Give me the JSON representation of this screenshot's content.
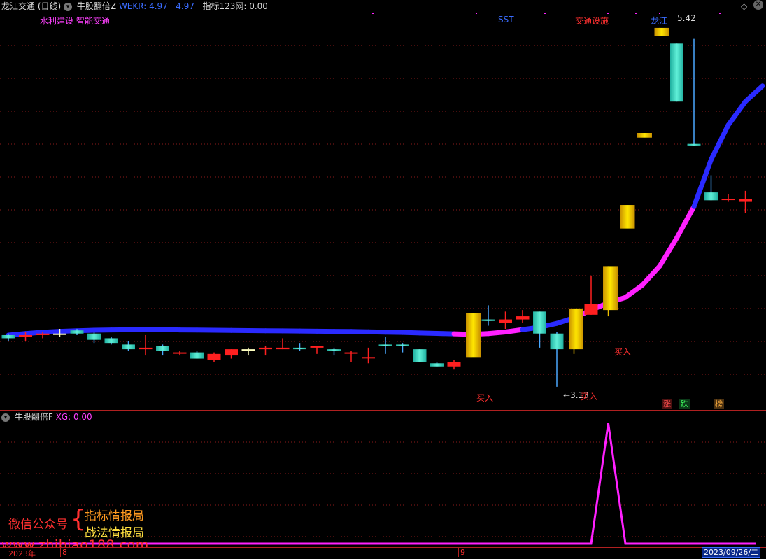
{
  "header": {
    "stock_name": "龙江交通",
    "period": "(日线)",
    "indicator_name": "牛股翻倍Z",
    "wekr_label": "WEKR:",
    "wekr_value": "4.97",
    "value2": "4.97",
    "index_label": "指标123网:",
    "index_value": "0.00"
  },
  "main_annotations": {
    "concepts": "水利建设 智能交通",
    "sst": "SST",
    "sector": "交通设施",
    "dragon_label": "龙江",
    "high_price": "5.42",
    "low_price": "3.13",
    "buy1": "买入",
    "buy2": "买入",
    "buy3": "买入"
  },
  "badges": {
    "rise": "涨",
    "fall": "跌",
    "rank": "榜"
  },
  "sub_header": {
    "name": "牛股翻倍F",
    "xg_label": "XG:",
    "xg_value": "0.00"
  },
  "watermark": {
    "wechat_label": "微信公众号",
    "brace": "{",
    "line1": "指标情报局",
    "line2": "战法情报局",
    "url": "www.zhibiao188.com"
  },
  "axis": {
    "year": "2023年",
    "tick1": "8",
    "tick2": "9",
    "date": "2023/09/26/二"
  },
  "colors": {
    "up": "#ff2020",
    "down": "#40d8c0",
    "gold": "#f0c000",
    "ma_blue": "#2a2aff",
    "ma_magenta": "#ff20ff",
    "grid": "#8b1a1a"
  },
  "chart_data": {
    "type": "candlestick",
    "y_range": [
      3.0,
      5.5
    ],
    "candles": [
      {
        "o": 3.46,
        "h": 3.47,
        "l": 3.42,
        "c": 3.44,
        "t": "down"
      },
      {
        "o": 3.45,
        "h": 3.48,
        "l": 3.42,
        "c": 3.46,
        "t": "up"
      },
      {
        "o": 3.46,
        "h": 3.48,
        "l": 3.44,
        "c": 3.47,
        "t": "up"
      },
      {
        "o": 3.47,
        "h": 3.5,
        "l": 3.45,
        "c": 3.47,
        "t": "doji"
      },
      {
        "o": 3.49,
        "h": 3.5,
        "l": 3.46,
        "c": 3.47,
        "t": "down"
      },
      {
        "o": 3.47,
        "h": 3.48,
        "l": 3.41,
        "c": 3.43,
        "t": "down"
      },
      {
        "o": 3.44,
        "h": 3.45,
        "l": 3.4,
        "c": 3.41,
        "t": "down"
      },
      {
        "o": 3.4,
        "h": 3.42,
        "l": 3.36,
        "c": 3.37,
        "t": "down"
      },
      {
        "o": 3.37,
        "h": 3.46,
        "l": 3.33,
        "c": 3.38,
        "t": "up"
      },
      {
        "o": 3.39,
        "h": 3.4,
        "l": 3.33,
        "c": 3.36,
        "t": "down"
      },
      {
        "o": 3.35,
        "h": 3.36,
        "l": 3.33,
        "c": 3.35,
        "t": "up"
      },
      {
        "o": 3.35,
        "h": 3.36,
        "l": 3.31,
        "c": 3.31,
        "t": "down"
      },
      {
        "o": 3.3,
        "h": 3.35,
        "l": 3.29,
        "c": 3.34,
        "t": "up"
      },
      {
        "o": 3.33,
        "h": 3.37,
        "l": 3.31,
        "c": 3.37,
        "t": "up"
      },
      {
        "o": 3.37,
        "h": 3.38,
        "l": 3.33,
        "c": 3.37,
        "t": "doji"
      },
      {
        "o": 3.37,
        "h": 3.39,
        "l": 3.33,
        "c": 3.38,
        "t": "up"
      },
      {
        "o": 3.37,
        "h": 3.44,
        "l": 3.37,
        "c": 3.38,
        "t": "up"
      },
      {
        "o": 3.38,
        "h": 3.41,
        "l": 3.36,
        "c": 3.37,
        "t": "down"
      },
      {
        "o": 3.38,
        "h": 3.39,
        "l": 3.34,
        "c": 3.39,
        "t": "up"
      },
      {
        "o": 3.37,
        "h": 3.38,
        "l": 3.33,
        "c": 3.36,
        "t": "down"
      },
      {
        "o": 3.35,
        "h": 3.36,
        "l": 3.29,
        "c": 3.35,
        "t": "up"
      },
      {
        "o": 3.32,
        "h": 3.38,
        "l": 3.28,
        "c": 3.32,
        "t": "up"
      },
      {
        "o": 3.39,
        "h": 3.45,
        "l": 3.34,
        "c": 3.4,
        "t": "down"
      },
      {
        "o": 3.39,
        "h": 3.41,
        "l": 3.35,
        "c": 3.4,
        "t": "down"
      },
      {
        "o": 3.37,
        "h": 3.37,
        "l": 3.29,
        "c": 3.29,
        "t": "down"
      },
      {
        "o": 3.28,
        "h": 3.29,
        "l": 3.26,
        "c": 3.26,
        "t": "down"
      },
      {
        "o": 3.26,
        "h": 3.3,
        "l": 3.24,
        "c": 3.29,
        "t": "up"
      },
      {
        "o": 3.32,
        "h": 3.6,
        "l": 3.32,
        "c": 3.6,
        "t": "gold"
      },
      {
        "o": 3.56,
        "h": 3.65,
        "l": 3.52,
        "c": 3.55,
        "t": "down"
      },
      {
        "o": 3.56,
        "h": 3.61,
        "l": 3.5,
        "c": 3.54,
        "t": "up"
      },
      {
        "o": 3.58,
        "h": 3.62,
        "l": 3.54,
        "c": 3.56,
        "t": "up"
      },
      {
        "o": 3.61,
        "h": 3.61,
        "l": 3.38,
        "c": 3.47,
        "t": "down"
      },
      {
        "o": 3.47,
        "h": 3.48,
        "l": 3.13,
        "c": 3.37,
        "t": "down"
      },
      {
        "o": 3.37,
        "h": 3.63,
        "l": 3.34,
        "c": 3.63,
        "t": "gold"
      },
      {
        "o": 3.59,
        "h": 3.84,
        "l": 3.59,
        "c": 3.66,
        "t": "up"
      },
      {
        "o": 3.62,
        "h": 3.9,
        "l": 3.58,
        "c": 3.9,
        "t": "gold"
      },
      {
        "o": 4.29,
        "h": 4.29,
        "l": 4.29,
        "c": 4.14,
        "t": "gold"
      },
      {
        "o": 4.75,
        "h": 4.75,
        "l": 4.73,
        "c": 4.72,
        "t": "gold"
      },
      {
        "o": 5.42,
        "h": 5.42,
        "l": 5.37,
        "c": 5.37,
        "t": "gold"
      },
      {
        "o": 5.32,
        "h": 5.32,
        "l": 4.95,
        "c": 4.95,
        "t": "down"
      },
      {
        "o": 4.68,
        "h": 5.35,
        "l": 4.67,
        "c": 4.67,
        "t": "down"
      },
      {
        "o": 4.37,
        "h": 4.48,
        "l": 4.32,
        "c": 4.32,
        "t": "down"
      },
      {
        "o": 4.33,
        "h": 4.36,
        "l": 4.31,
        "c": 4.33,
        "t": "up"
      },
      {
        "o": 4.31,
        "h": 4.38,
        "l": 4.24,
        "c": 4.33,
        "t": "up"
      }
    ],
    "ma_line": [
      {
        "v": 3.46,
        "c": "blue"
      },
      {
        "v": 3.47,
        "c": "blue"
      },
      {
        "v": 3.478,
        "c": "blue"
      },
      {
        "v": 3.484,
        "c": "blue"
      },
      {
        "v": 3.488,
        "c": "blue"
      },
      {
        "v": 3.491,
        "c": "blue"
      },
      {
        "v": 3.493,
        "c": "blue"
      },
      {
        "v": 3.494,
        "c": "blue"
      },
      {
        "v": 3.494,
        "c": "blue"
      },
      {
        "v": 3.494,
        "c": "blue"
      },
      {
        "v": 3.493,
        "c": "blue"
      },
      {
        "v": 3.492,
        "c": "blue"
      },
      {
        "v": 3.491,
        "c": "blue"
      },
      {
        "v": 3.49,
        "c": "blue"
      },
      {
        "v": 3.489,
        "c": "blue"
      },
      {
        "v": 3.488,
        "c": "blue"
      },
      {
        "v": 3.487,
        "c": "blue"
      },
      {
        "v": 3.486,
        "c": "blue"
      },
      {
        "v": 3.485,
        "c": "blue"
      },
      {
        "v": 3.484,
        "c": "blue"
      },
      {
        "v": 3.483,
        "c": "blue"
      },
      {
        "v": 3.481,
        "c": "blue"
      },
      {
        "v": 3.479,
        "c": "blue"
      },
      {
        "v": 3.477,
        "c": "blue"
      },
      {
        "v": 3.474,
        "c": "blue"
      },
      {
        "v": 3.471,
        "c": "blue"
      },
      {
        "v": 3.468,
        "c": "blue"
      },
      {
        "v": 3.465,
        "c": "magenta"
      },
      {
        "v": 3.47,
        "c": "magenta"
      },
      {
        "v": 3.48,
        "c": "magenta"
      },
      {
        "v": 3.495,
        "c": "magenta"
      },
      {
        "v": 3.51,
        "c": "blue"
      },
      {
        "v": 3.535,
        "c": "blue"
      },
      {
        "v": 3.57,
        "c": "blue"
      },
      {
        "v": 3.62,
        "c": "magenta"
      },
      {
        "v": 3.665,
        "c": "magenta"
      },
      {
        "v": 3.7,
        "c": "magenta"
      },
      {
        "v": 3.78,
        "c": "magenta"
      },
      {
        "v": 3.9,
        "c": "magenta"
      },
      {
        "v": 4.08,
        "c": "magenta"
      },
      {
        "v": 4.28,
        "c": "magenta"
      },
      {
        "v": 4.58,
        "c": "blue"
      },
      {
        "v": 4.8,
        "c": "blue"
      },
      {
        "v": 4.95,
        "c": "blue"
      },
      {
        "v": 5.05,
        "c": "blue"
      }
    ],
    "sub_series": {
      "name": "XG",
      "spike_index": 35,
      "spike_value": 1
    }
  }
}
